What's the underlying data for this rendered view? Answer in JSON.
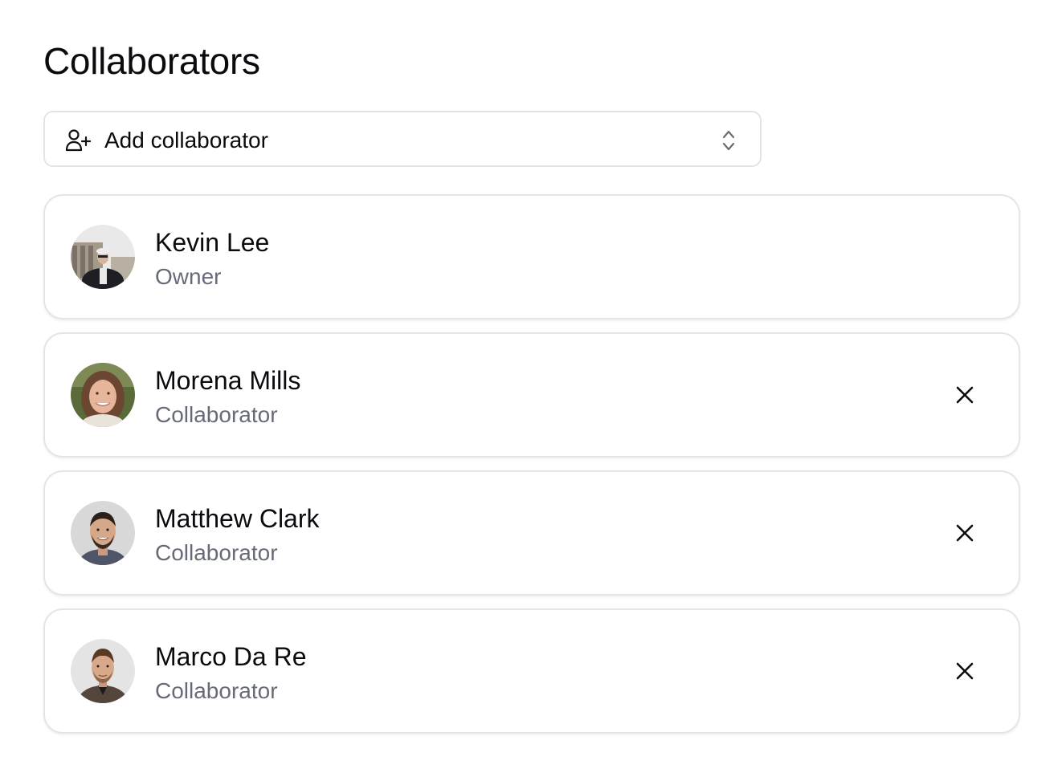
{
  "header": {
    "title": "Collaborators"
  },
  "add_collaborator": {
    "label": "Add collaborator",
    "icon": "user-plus-icon",
    "chevron_icon": "chevron-up-down-icon"
  },
  "collaborators": [
    {
      "name": "Kevin Lee",
      "role": "Owner",
      "removable": false
    },
    {
      "name": "Morena Mills",
      "role": "Collaborator",
      "removable": true
    },
    {
      "name": "Matthew Clark",
      "role": "Collaborator",
      "removable": true
    },
    {
      "name": "Marco Da Re",
      "role": "Collaborator",
      "removable": true
    }
  ],
  "colors": {
    "text_primary": "#0b0b0f",
    "text_secondary": "#676b78",
    "border": "#e5e5e9"
  }
}
